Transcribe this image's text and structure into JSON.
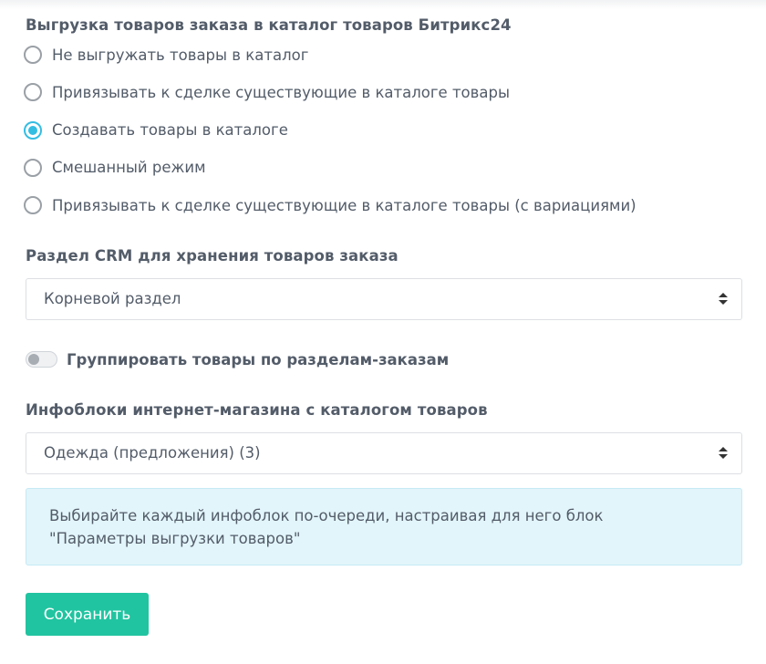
{
  "export_section": {
    "title": "Выгрузка товаров заказа в каталог товаров Битрикс24",
    "options": [
      {
        "label": "Не выгружать товары в каталог",
        "checked": false
      },
      {
        "label": "Привязывать к сделке существующие в каталоге товары",
        "checked": false
      },
      {
        "label": "Создавать товары в каталоге",
        "checked": true
      },
      {
        "label": "Смешанный режим",
        "checked": false
      },
      {
        "label": "Привязывать к сделке существующие в каталоге товары (с вариациями)",
        "checked": false
      }
    ]
  },
  "crm_section": {
    "title": "Раздел CRM для хранения товаров заказа",
    "selected": "Корневой раздел"
  },
  "group_toggle": {
    "label": "Группировать товары по разделам-заказам",
    "on": false
  },
  "iblock_section": {
    "title": "Инфоблоки интернет-магазина с каталогом товаров",
    "selected": "Одежда (предложения) (3)"
  },
  "info": {
    "line1": "Выбирайте каждый инфоблок по-очереди, настраивая для него блок",
    "line2": "\"Параметры выгрузки товаров\""
  },
  "save_button": {
    "label": "Сохранить"
  },
  "colors": {
    "accent": "#34bde2",
    "button": "#21c4a0",
    "info_bg": "#e2f5fa",
    "text": "#535c69"
  }
}
